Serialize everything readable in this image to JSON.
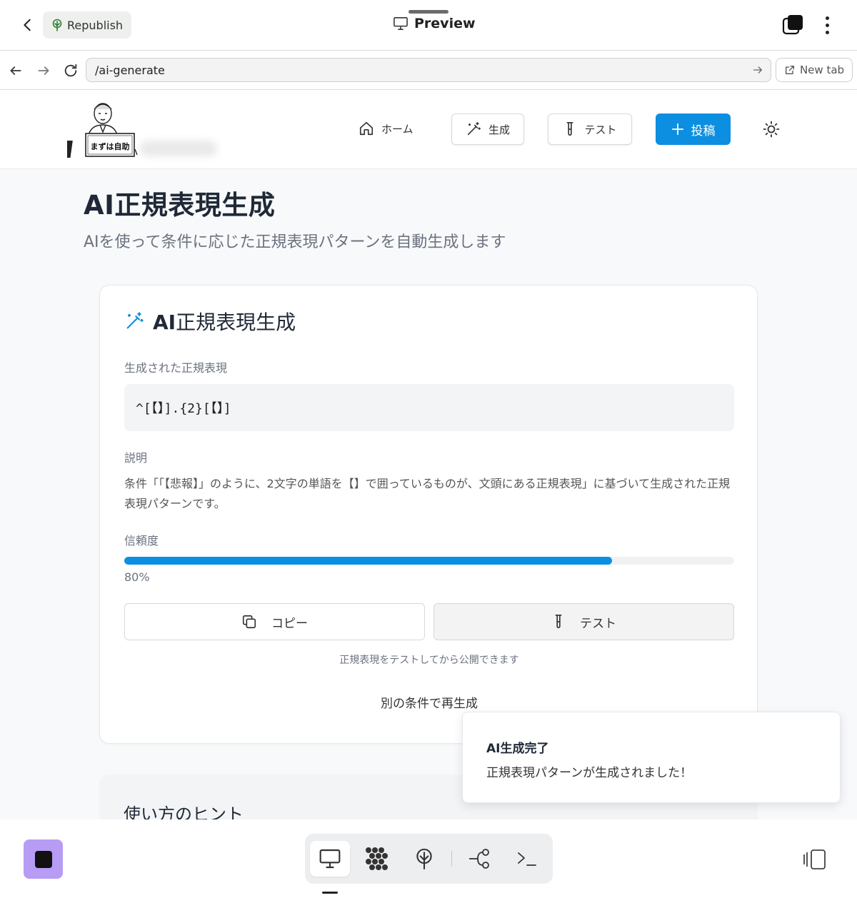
{
  "topbar": {
    "republish_label": "Republish",
    "title": "Preview"
  },
  "addressbar": {
    "url": "/ai-generate",
    "new_tab_label": "New tab"
  },
  "site": {
    "logo_text": "まずは自助",
    "nav": {
      "home": "ホーム",
      "generate": "生成",
      "test": "テスト",
      "post": "投稿"
    }
  },
  "page": {
    "title_prefix": "AI",
    "title_rest": "正規表現生成",
    "subtitle": "AIを使って条件に応じた正規表現パターンを自動生成します"
  },
  "card": {
    "title_prefix": "AI",
    "title_rest": "正規表現生成",
    "regex_label": "生成された正規表現",
    "regex_value": "^[【】].{2}[【】]",
    "desc_label": "説明",
    "description": "条件「「【悲報】」のように、2文字の単語を【】で囲っているものが、文頭にある正規表現」に基づいて生成された正規表現パターンです。",
    "confidence_label": "信頼度",
    "confidence_value": 0.8,
    "confidence_text": "80%",
    "copy_label": "コピー",
    "test_label": "テスト",
    "note": "正規表現をテストしてから公開できます",
    "regenerate_label": "別の条件で再生成"
  },
  "tips": {
    "title": "使い方のヒント"
  },
  "toast": {
    "title": "AI生成完了",
    "message": "正規表現パターンが生成されました！"
  },
  "colors": {
    "accent": "#0c8fe0",
    "stop_button": "#b69cf5"
  },
  "icons": {
    "back": "chevron-left-icon",
    "republish": "tree-icon",
    "preview": "monitor-icon",
    "tabs": "tabs-icon",
    "menu": "more-vertical-icon",
    "nav_back": "arrow-left-icon",
    "nav_forward": "arrow-right-icon",
    "reload": "reload-icon",
    "go": "arrow-right-icon",
    "external": "external-link-icon",
    "home": "home-icon",
    "wand": "magic-wand-icon",
    "test_tube": "test-tube-icon",
    "plus": "plus-icon",
    "sun": "sun-icon",
    "copy": "copy-icon",
    "stop": "stop-icon",
    "dock_preview": "monitor-icon",
    "dock_apps": "grid-icon",
    "dock_deploy": "tree-icon",
    "dock_flow": "workflow-icon",
    "dock_terminal": "terminal-icon",
    "panel": "sidebar-panel-icon"
  }
}
